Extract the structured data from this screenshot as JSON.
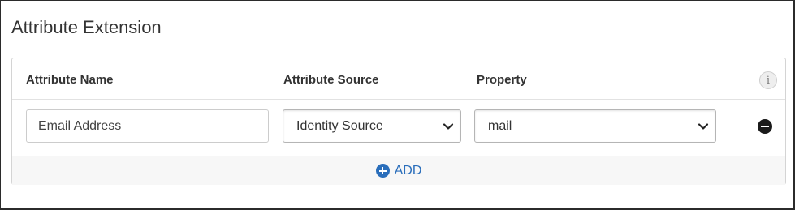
{
  "section": {
    "title": "Attribute Extension"
  },
  "table": {
    "headers": {
      "attribute_name": "Attribute Name",
      "attribute_source": "Attribute Source",
      "property": "Property",
      "info_icon_glyph": "i"
    },
    "rows": [
      {
        "attribute_name_value": "Email Address",
        "attribute_source_selected": "Identity Source",
        "property_selected": "mail"
      }
    ]
  },
  "footer": {
    "add_label": "ADD"
  },
  "icons": {
    "info": "info-icon",
    "remove": "minus-circle-icon",
    "add": "plus-circle-icon",
    "dropdown": "chevron-down-icon"
  },
  "colors": {
    "link_blue": "#2a6ebb",
    "remove_black": "#1a1a1a"
  }
}
